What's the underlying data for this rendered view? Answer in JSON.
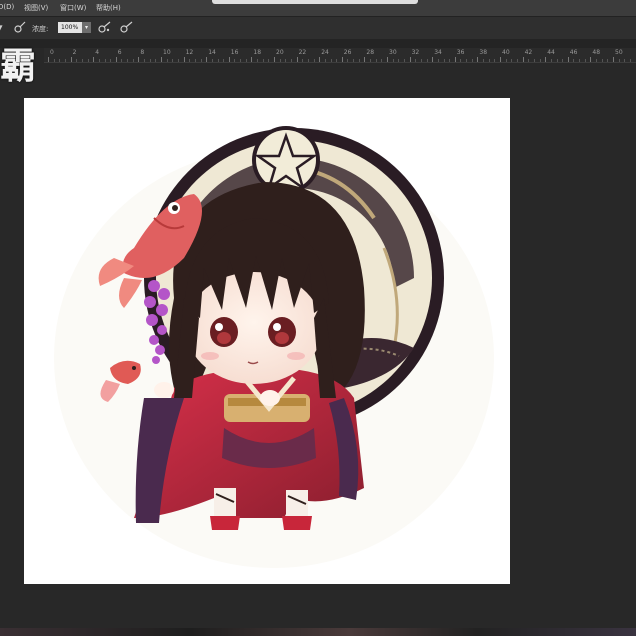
{
  "menu": {
    "items": [
      "D(D)",
      "视图(V)",
      "窗口(W)",
      "帮助(H)"
    ]
  },
  "options_bar": {
    "opacity_label": "浓度:",
    "opacity_value": "100%",
    "dropdown_glyph": "▾"
  },
  "ruler": {
    "labels": [
      "0",
      "2",
      "4",
      "6",
      "8",
      "10",
      "12",
      "14",
      "16",
      "18",
      "20",
      "22",
      "24",
      "26",
      "28",
      "30",
      "32",
      "34",
      "36",
      "38",
      "40",
      "42",
      "44",
      "46",
      "48",
      "50"
    ]
  },
  "badge_char": "霸",
  "artwork": {
    "subject": "chibi girl in kimono with goldfish hair ornament and ornate parasol",
    "colors": {
      "hair": "#2f1f1c",
      "kimono_red": "#c8263a",
      "kimono_purple": "#4a2a4e",
      "goldfish": "#e06060",
      "parasol_dark": "#2a1c24",
      "parasol_light": "#efe8d4",
      "wisteria": "#b455c8",
      "obi_gold": "#d8b070"
    }
  },
  "icons": [
    "brush-icon",
    "airbrush-icon",
    "pressure-opacity-icon",
    "pressure-size-icon"
  ]
}
